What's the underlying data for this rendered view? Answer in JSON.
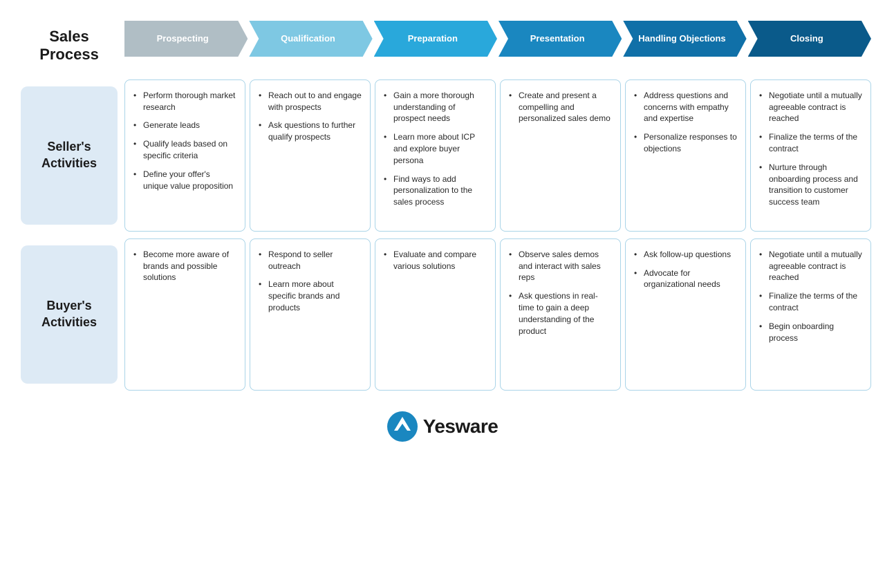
{
  "header": {
    "sales_process_label": "Sales Process",
    "arrows": [
      {
        "key": "prospecting",
        "label": "Prospecting",
        "color": "#b0bec5"
      },
      {
        "key": "qualification",
        "label": "Qualification",
        "color": "#7ec8e3"
      },
      {
        "key": "preparation",
        "label": "Preparation",
        "color": "#29a8db"
      },
      {
        "key": "presentation",
        "label": "Presentation",
        "color": "#1a87c0"
      },
      {
        "key": "handling",
        "label": "Handling Objections",
        "color": "#1070a8"
      },
      {
        "key": "closing",
        "label": "Closing",
        "color": "#0a5a8a"
      }
    ]
  },
  "sellers": {
    "label": "Seller's Activities",
    "cells": [
      {
        "stage": "prospecting",
        "items": [
          "Perform thorough market research",
          "Generate leads",
          "Qualify leads based on specific criteria",
          "Define your offer's unique value proposition"
        ]
      },
      {
        "stage": "qualification",
        "items": [
          "Reach out to and engage with prospects",
          "Ask questions to further qualify prospects"
        ]
      },
      {
        "stage": "preparation",
        "items": [
          "Gain a more thorough understanding of prospect needs",
          "Learn more about ICP and explore buyer persona",
          "Find ways to add personalization to the sales process"
        ]
      },
      {
        "stage": "presentation",
        "items": [
          "Create and present a compelling and personalized sales demo"
        ]
      },
      {
        "stage": "handling",
        "items": [
          "Address questions and concerns with empathy and expertise",
          "Personalize responses to objections"
        ]
      },
      {
        "stage": "closing",
        "items": [
          "Negotiate until a mutually agreeable contract is reached",
          "Finalize the terms of the contract",
          "Nurture through onboarding process and transition to customer success team"
        ]
      }
    ]
  },
  "buyers": {
    "label": "Buyer's Activities",
    "cells": [
      {
        "stage": "prospecting",
        "items": [
          "Become more aware of brands and possible solutions"
        ]
      },
      {
        "stage": "qualification",
        "items": [
          "Respond to seller outreach",
          "Learn more about specific brands and products"
        ]
      },
      {
        "stage": "preparation",
        "items": [
          "Evaluate and compare various solutions"
        ]
      },
      {
        "stage": "presentation",
        "items": [
          "Observe sales demos and interact with sales reps",
          "Ask questions in real-time to gain a deep understanding of the product"
        ]
      },
      {
        "stage": "handling",
        "items": [
          "Ask follow-up questions",
          "Advocate for organizational needs"
        ]
      },
      {
        "stage": "closing",
        "items": [
          "Negotiate until a mutually agreeable contract is reached",
          "Finalize the terms of the contract",
          "Begin onboarding process"
        ]
      }
    ]
  },
  "footer": {
    "brand_name": "Yesware"
  }
}
